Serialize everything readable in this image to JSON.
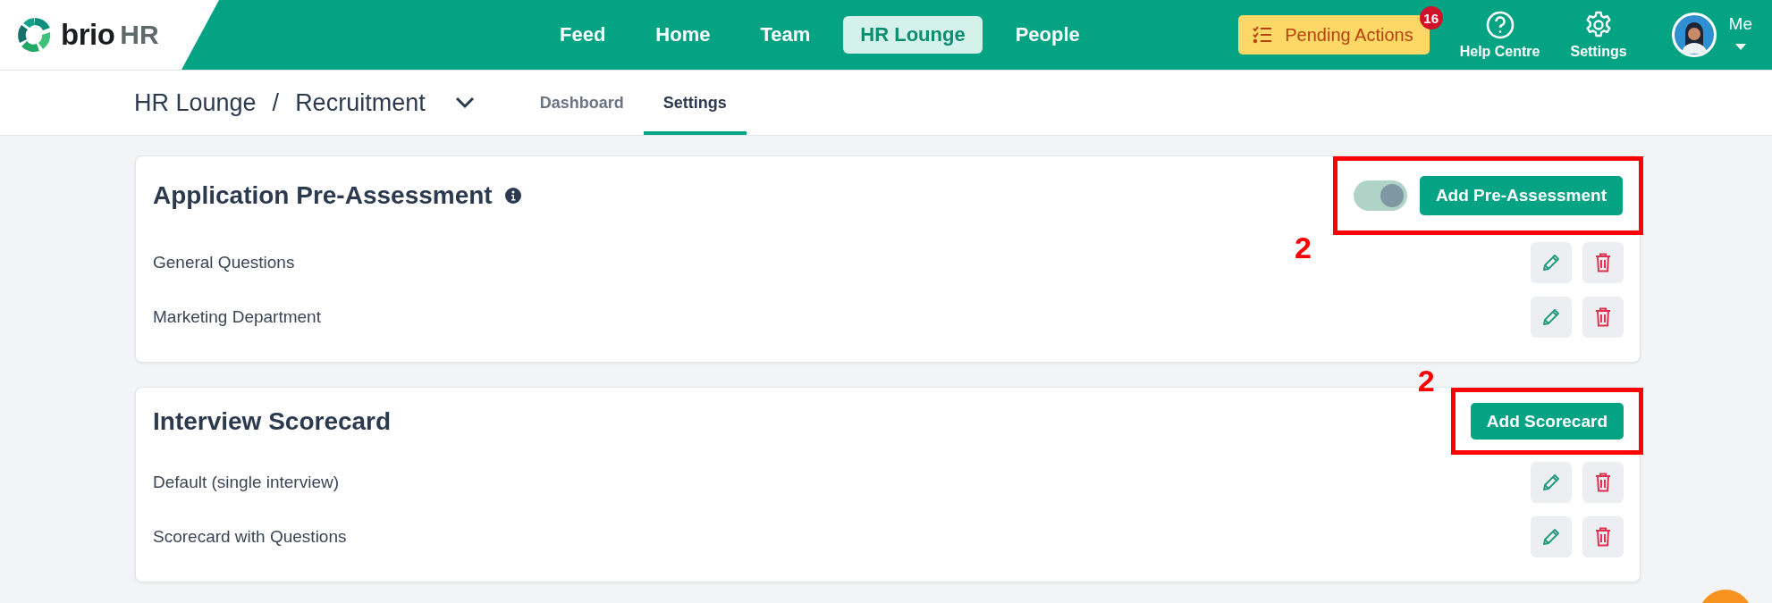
{
  "header": {
    "logo": {
      "word": "brio",
      "suffix": "HR"
    },
    "nav": [
      {
        "label": "Feed",
        "selected": false
      },
      {
        "label": "Home",
        "selected": false
      },
      {
        "label": "Team",
        "selected": false
      },
      {
        "label": "HR Lounge",
        "selected": true
      },
      {
        "label": "People",
        "selected": false
      }
    ],
    "pending": {
      "label": "Pending Actions",
      "count": "16"
    },
    "help": "Help Centre",
    "settings": "Settings",
    "user": "Me"
  },
  "breadcrumb": {
    "parent": "HR Lounge",
    "separator": "/",
    "current": "Recruitment"
  },
  "tabs": [
    {
      "label": "Dashboard",
      "selected": false
    },
    {
      "label": "Settings",
      "selected": true
    }
  ],
  "sections": [
    {
      "title": "Application Pre-Assessment",
      "info": true,
      "toggle": {
        "on": true
      },
      "button": "Add Pre-Assessment",
      "items": [
        "General Questions",
        "Marketing Department"
      ],
      "annotation": "2"
    },
    {
      "title": "Interview Scorecard",
      "info": false,
      "button": "Add Scorecard",
      "items": [
        "Default (single interview)",
        "Scorecard with Questions"
      ],
      "annotation": "2"
    }
  ]
}
